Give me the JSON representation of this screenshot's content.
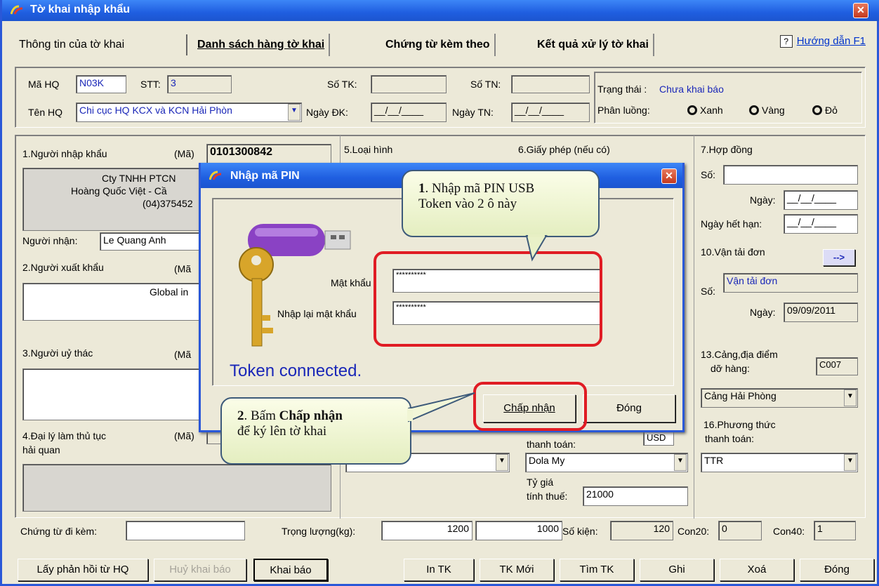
{
  "window": {
    "title": "Tờ khai nhập khẩu"
  },
  "tabs": [
    {
      "label": "Thông tin của tờ khai"
    },
    {
      "label": "Danh sách hàng tờ khai"
    },
    {
      "label": "Chứng từ kèm theo"
    },
    {
      "label": "Kết quả xử lý tờ khai"
    }
  ],
  "help_link": "Hướng dẫn F1",
  "header": {
    "ma_hq_label": "Mã HQ",
    "ma_hq_value": "N03K",
    "stt_label": "STT:",
    "stt_value": "3",
    "so_tk_label": "Số TK:",
    "so_tn_label": "Số TN:",
    "ten_hq_label": "Tên HQ",
    "ten_hq_value": "Chi cục HQ KCX và KCN Hải Phòn",
    "ngay_dk_label": "Ngày ĐK:",
    "ngay_dk_value": "__/__/____",
    "ngay_tn_label": "Ngày TN:",
    "ngay_tn_value": "__/__/____",
    "trang_thai_label": "Trạng thái :",
    "trang_thai_value": "Chưa khai báo",
    "phan_luong_label": "Phân luồng:",
    "phan_luong_options": [
      "Xanh",
      "Vàng",
      "Đỏ"
    ]
  },
  "form": {
    "nguoi_nhap_khau_label": "1.Người nhập khẩu",
    "ma_label": "(Mã)",
    "nguoi_nhap_khau_ma": "0101300842",
    "nguoi_nhap_khau_line1": "Cty TNHH PTCN",
    "nguoi_nhap_khau_line2": "Hoàng Quốc Việt - Cầ",
    "nguoi_nhap_khau_line3": "(04)375452",
    "nguoi_nhan_label": "Người nhận:",
    "nguoi_nhan_value": "Le Quang Anh",
    "nguoi_xuat_khau_label": "2.Người xuất khẩu",
    "ma_short": "(Mã",
    "nguoi_xuat_khau_value": "Global in",
    "nguoi_uy_thac_label": "3.Người uỷ thác",
    "dai_ly_label_1": "4.Đại lý làm thủ tục",
    "dai_ly_label_2": "hải quan",
    "loai_hinh_label": "5.Loại hình",
    "giay_phep_label": "6.Giấy phép (nếu có)",
    "hop_dong_label": "7.Hợp đồng",
    "so_label": "Số:",
    "ngay_label": "Ngày:",
    "ngay_value": "__/__/____",
    "ngay_het_han_label": "Ngày hết hạn:",
    "ngay_het_han_value": "__/__/____",
    "van_tai_don_label": "10.Vận tải đơn",
    "van_tai_arrow": "-->",
    "van_tai_so_value": "Vận tải đơn",
    "van_tai_ngay_value": "09/09/2011",
    "cang_label_1": "13.Cảng,địa điểm",
    "cang_label_2": "dỡ hàng:",
    "cang_code": "C007",
    "cang_value": "Cảng Hải Phòng",
    "thanh_toan_label": "thanh toán:",
    "currency_code": "USD",
    "currency_value": "Dola My",
    "ty_gia_label_1": "Tỷ giá",
    "ty_gia_label_2": "tính thuế:",
    "ty_gia_value": "21000",
    "phuong_thuc_label_1": "16.Phương thức",
    "phuong_thuc_label_2": "thanh toán:",
    "phuong_thuc_value": "TTR"
  },
  "footer_fields": {
    "chung_tu_label": "Chứng từ đi kèm:",
    "trong_luong_label": "Trọng lượng(kg):",
    "trong_luong_1": "1200",
    "trong_luong_2": "1000",
    "so_kien_label": "Số kiện:",
    "so_kien_value": "120",
    "con20_label": "Con20:",
    "con20_value": "0",
    "con40_label": "Con40:",
    "con40_value": "1"
  },
  "toolbar": {
    "lay_phan_hoi": "Lấy phản hồi từ HQ",
    "huy_khai_bao": "Huỷ khai báo",
    "khai_bao": "Khai báo",
    "in_tk": "In TK",
    "tk_moi": "TK Mới",
    "tim_tk": "Tìm TK",
    "ghi": "Ghi",
    "xoa": "Xoá",
    "dong": "Đóng"
  },
  "dialog": {
    "title": "Nhập mã PIN",
    "password_label": "Mật khẩu",
    "password_value": "**********",
    "confirm_label": "Nhập lại mật khẩu",
    "confirm_value": "**********",
    "status": "Token connected.",
    "accept": "Chấp nhận",
    "close": "Đóng"
  },
  "callouts": {
    "c1_num": "1",
    "c1_text_a": ". Nhập mã PIN USB",
    "c1_text_b": "Token vào 2 ô này",
    "c2_num": "2",
    "c2_text_a": ". Bấm ",
    "c2_bold": "Chấp nhận",
    "c2_text_b": "để ký lên tờ khai"
  },
  "colors": {
    "title_bar": "#1f5ee0",
    "highlight": "#e01c24",
    "status_text": "#1a27b8",
    "callout_bg": "#eef3d2"
  }
}
